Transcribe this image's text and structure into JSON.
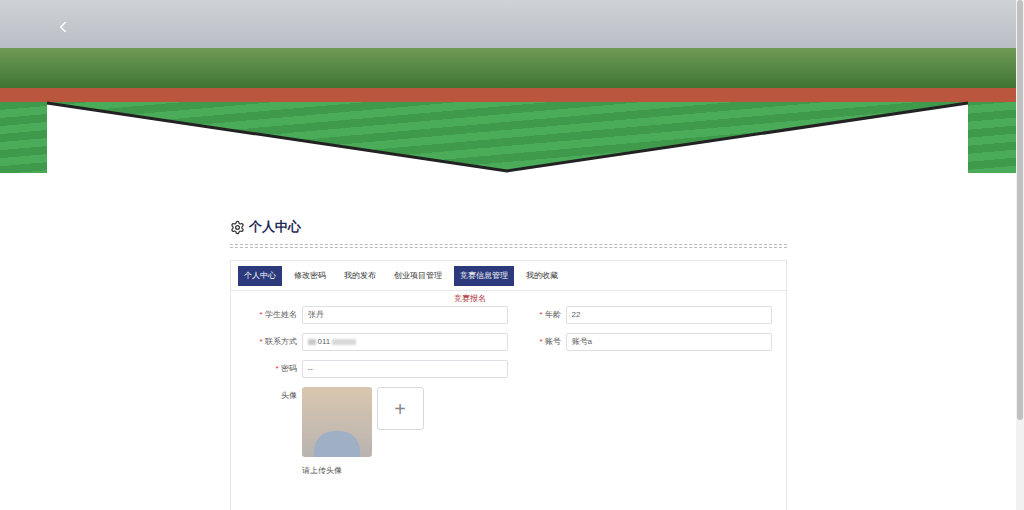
{
  "page_title": "个人中心",
  "tabs": [
    {
      "label": "个人中心",
      "selected": true,
      "hovered": false
    },
    {
      "label": "修改密码",
      "selected": false,
      "hovered": false
    },
    {
      "label": "我的发布",
      "selected": false,
      "hovered": false
    },
    {
      "label": "创业项目管理",
      "selected": false,
      "hovered": false
    },
    {
      "label": "竞赛信息管理",
      "selected": false,
      "hovered": true
    },
    {
      "label": "我的收藏",
      "selected": false,
      "hovered": false
    }
  ],
  "tab_menu": {
    "items": [
      "竞赛报名"
    ]
  },
  "form": {
    "required_mark": "*",
    "fields": [
      {
        "label": "学生姓名",
        "value": "张丹",
        "required": true,
        "redacted": false
      },
      {
        "label": "年龄",
        "value": "22",
        "required": true,
        "redacted": false
      },
      {
        "label": "联系方式",
        "value": "011",
        "required": true,
        "redacted": true
      },
      {
        "label": "账号",
        "value": "账号a",
        "required": true,
        "redacted": false
      },
      {
        "label": "密码",
        "value": "--",
        "required": true,
        "redacted": false
      }
    ]
  },
  "avatar": {
    "label": "头像",
    "upload_icon": "+",
    "hint": "请上传头像"
  }
}
